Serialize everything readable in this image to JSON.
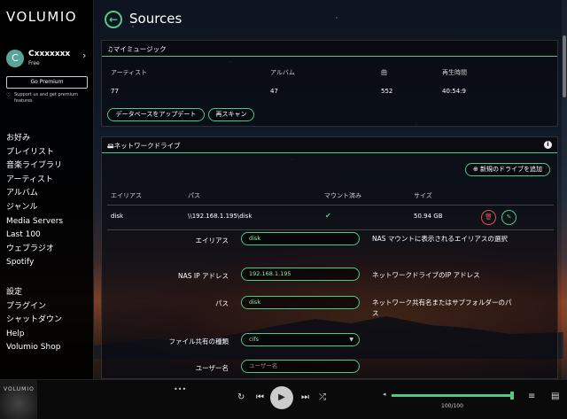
{
  "sidebar": {
    "logo": "VOLUMIO",
    "user": {
      "initial": "C",
      "name": "Cxxxxxxx",
      "plan": "Free"
    },
    "premium_button": "Go Premium",
    "support_text": "Support us and get premium features",
    "nav_main": [
      "お好み",
      "プレイリスト",
      "音楽ライブラリ",
      "アーティスト",
      "アルバム",
      "ジャンル",
      "Media Servers",
      "Last 100",
      "ウェブラジオ",
      "Spotify"
    ],
    "nav_secondary": [
      "設定",
      "プラグイン",
      "シャットダウン",
      "Help",
      "Volumio Shop"
    ]
  },
  "header": {
    "title": "Sources"
  },
  "my_music": {
    "title": "マイミュージック",
    "columns": [
      "アーティスト",
      "アルバム",
      "曲",
      "再生時間"
    ],
    "values": [
      "77",
      "47",
      "552",
      "40:54:9"
    ],
    "buttons": {
      "update_db": "データベースをアップデート",
      "rescan": "再スキャン"
    }
  },
  "network_drives": {
    "title": "ネットワークドライブ",
    "add_button": "新規のドライブを追加",
    "columns": [
      "エイリアス",
      "パス",
      "マウント済み",
      "サイズ"
    ],
    "rows": [
      {
        "alias": "disk",
        "path": "\\\\192.168.1.195\\disk",
        "mounted": "✔",
        "size": "50.94 GB"
      }
    ],
    "form": {
      "alias_label": "エイリアス",
      "alias_value": "disk",
      "alias_help": "NAS マウントに表示されるエイリアスの選択",
      "ip_label": "NAS IP アドレス",
      "ip_value": "192.168.1.195",
      "ip_help": "ネットワークドライブのIP アドレス",
      "path_label": "パス",
      "path_value": "disk",
      "path_help": "ネットワーク共有名またはサブフォルダーのパス",
      "share_type_label": "ファイル共有の種類",
      "share_type_value": "cifs",
      "username_label": "ユーザー名",
      "username_placeholder": "ユーザー名"
    }
  },
  "player": {
    "thumb_logo": "VOLUMIO",
    "volume_text": "100/100",
    "volume_level": 1.0
  },
  "colors": {
    "accent": "#54c688",
    "danger": "#d9534f"
  }
}
